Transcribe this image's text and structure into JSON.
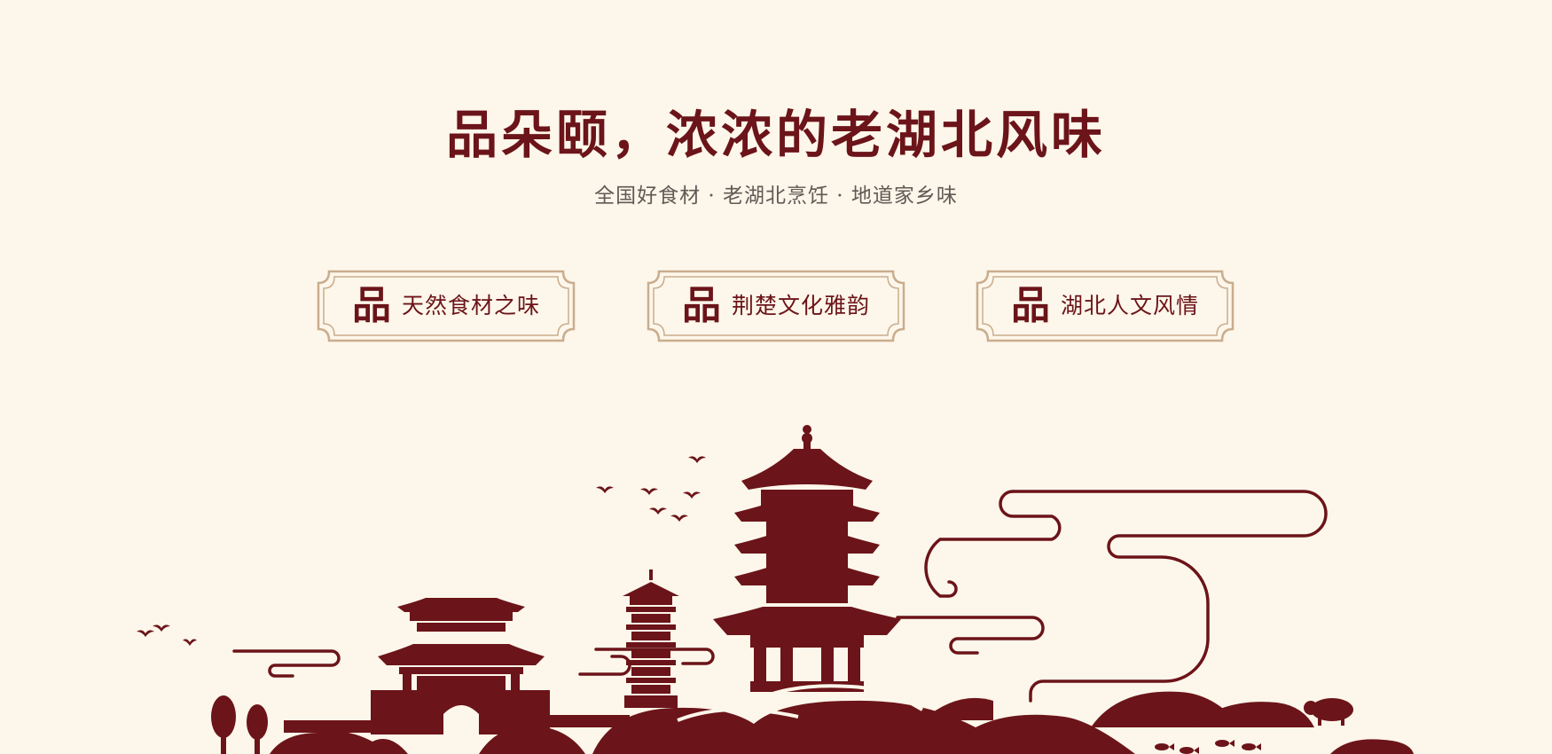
{
  "hero": {
    "title": "品朵颐，浓浓的老湖北风味",
    "subtitle": "全国好食材 · 老湖北烹饪 · 地道家乡味"
  },
  "badges": [
    {
      "char": "品",
      "label": "天然食材之味"
    },
    {
      "char": "品",
      "label": "荆楚文化雅韵"
    },
    {
      "char": "品",
      "label": "湖北人文风情"
    }
  ],
  "icons": {
    "skyline": "city-skyline-illustration",
    "cloud": "auspicious-cloud-icon",
    "bird": "bird-icon",
    "tree": "tree-icon",
    "pig": "pig-icon",
    "fish": "fish-icon"
  },
  "colors": {
    "background": "#fdf6ea",
    "brand": "#6b1419",
    "subtitle_text": "#5f5a55",
    "badge_border": "#c9ad8d"
  }
}
